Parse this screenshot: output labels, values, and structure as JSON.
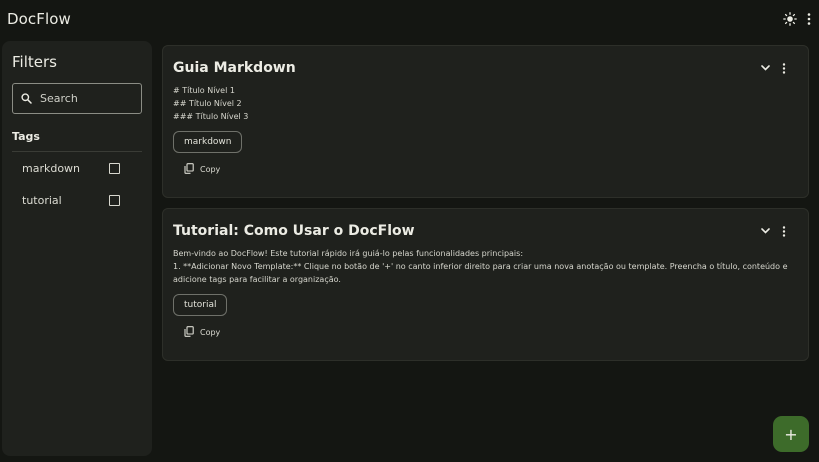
{
  "app": {
    "title": "DocFlow"
  },
  "topbar": {
    "theme_icon": "sun-icon",
    "menu_icon": "more-vert-icon"
  },
  "sidebar": {
    "title": "Filters",
    "search": {
      "placeholder": "Search",
      "value": ""
    },
    "tags_heading": "Tags",
    "tags": [
      {
        "label": "markdown",
        "checked": false
      },
      {
        "label": "tutorial",
        "checked": false
      }
    ]
  },
  "cards": [
    {
      "title": "Guia Markdown",
      "lines": [
        "# Título Nível 1",
        "## Título Nível 2",
        "### Título Nível 3"
      ],
      "tag": "markdown",
      "copy_label": "Copy"
    },
    {
      "title": "Tutorial: Como Usar o DocFlow",
      "lines": [
        "Bem-vindo ao DocFlow! Este tutorial rápido irá guiá-lo pelas funcionalidades principais:",
        "1.  **Adicionar Novo Template:** Clique no botão de '+' no canto inferior direito para criar uma nova anotação ou template. Preencha o título, conteúdo e adicione tags para facilitar a organização."
      ],
      "tag": "tutorial",
      "copy_label": "Copy"
    }
  ],
  "fab": {
    "label": "+"
  },
  "colors": {
    "accent": "#3d6b2a",
    "background": "#141612",
    "surface": "#1f211d"
  }
}
